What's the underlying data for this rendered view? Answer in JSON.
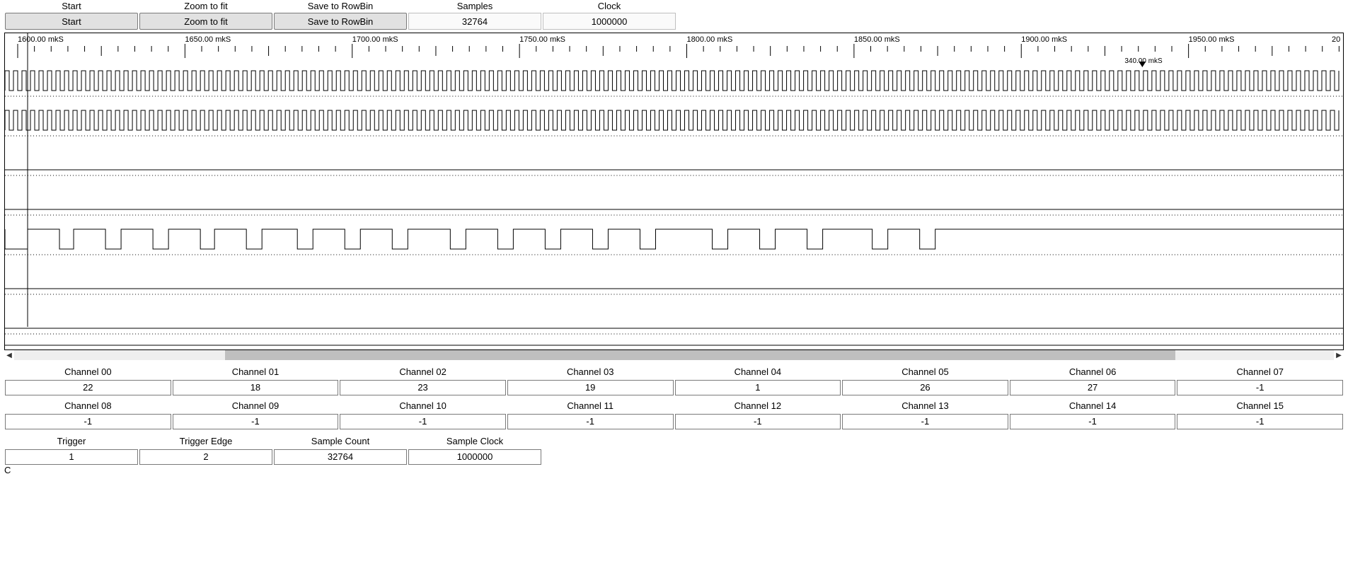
{
  "toolbar": {
    "headers": [
      "Start",
      "Zoom to fit",
      "Save to RowBin",
      "Samples",
      "Clock"
    ],
    "start_btn": "Start",
    "zoom_btn": "Zoom to fit",
    "save_btn": "Save to RowBin",
    "samples_value": "32764",
    "clock_value": "1000000"
  },
  "ruler": {
    "unit": "mkS",
    "major_ticks": [
      "1600.00 mkS",
      "1650.00 mkS",
      "1700.00 mkS",
      "1750.00 mkS",
      "1800.00 mkS",
      "1850.00 mkS",
      "1900.00 mkS",
      "1950.00 mkS"
    ],
    "right_edge_label": "20",
    "marker_label": "340.00 mkS",
    "marker_position_pct": 85
  },
  "channels_top": {
    "headers": [
      "Channel 00",
      "Channel 01",
      "Channel 02",
      "Channel 03",
      "Channel 04",
      "Channel 05",
      "Channel 06",
      "Channel 07"
    ],
    "values": [
      "22",
      "18",
      "23",
      "19",
      "1",
      "26",
      "27",
      "-1"
    ]
  },
  "channels_bottom": {
    "headers": [
      "Channel 08",
      "Channel 09",
      "Channel 10",
      "Channel 11",
      "Channel 12",
      "Channel 13",
      "Channel 14",
      "Channel 15"
    ],
    "values": [
      "-1",
      "-1",
      "-1",
      "-1",
      "-1",
      "-1",
      "-1",
      "-1"
    ]
  },
  "config": {
    "headers": [
      "Trigger",
      "Trigger Edge",
      "Sample Count",
      "Sample Clock"
    ],
    "values": [
      "1",
      "2",
      "32764",
      "1000000"
    ]
  },
  "footer_char": "C",
  "scrollbar": {
    "thumb_left_pct": 16,
    "thumb_width_pct": 72
  },
  "waveform": {
    "tracks": [
      {
        "name": "track-0",
        "type": "fast"
      },
      {
        "name": "track-1",
        "type": "fast"
      },
      {
        "name": "track-2",
        "type": "flat-low"
      },
      {
        "name": "track-3",
        "type": "flat-low"
      },
      {
        "name": "track-4",
        "type": "word"
      },
      {
        "name": "track-5",
        "type": "flat-low"
      },
      {
        "name": "track-6",
        "type": "flat-low"
      }
    ]
  }
}
